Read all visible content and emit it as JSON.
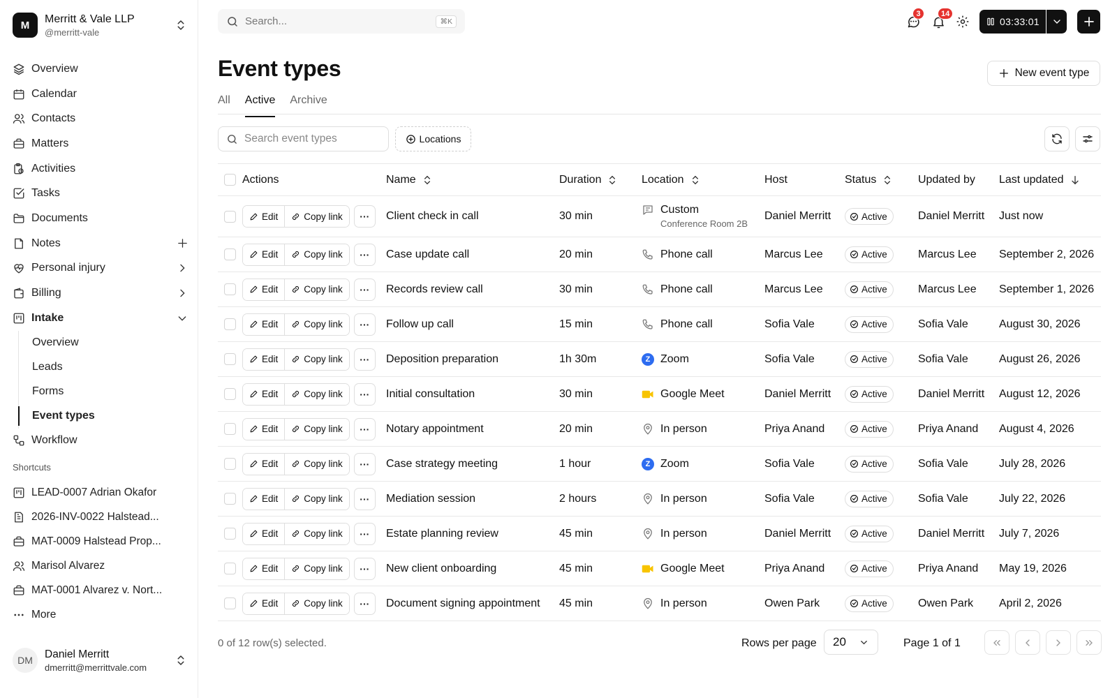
{
  "org": {
    "initial": "M",
    "name": "Merritt & Vale LLP",
    "handle": "@merritt-vale"
  },
  "nav": {
    "items": [
      {
        "label": "Overview",
        "icon": "layers-icon"
      },
      {
        "label": "Calendar",
        "icon": "calendar-icon"
      },
      {
        "label": "Contacts",
        "icon": "users-icon"
      },
      {
        "label": "Matters",
        "icon": "briefcase-icon"
      },
      {
        "label": "Activities",
        "icon": "activity-clipboard-icon"
      },
      {
        "label": "Tasks",
        "icon": "checkbox-icon"
      },
      {
        "label": "Documents",
        "icon": "folder-icon"
      },
      {
        "label": "Notes",
        "icon": "note-icon"
      },
      {
        "label": "Personal injury",
        "icon": "heart-pulse-icon"
      },
      {
        "label": "Billing",
        "icon": "wallet-icon"
      },
      {
        "label": "Intake",
        "icon": "kanban-icon"
      }
    ],
    "intake_sub": [
      "Overview",
      "Leads",
      "Forms",
      "Event types"
    ],
    "workflow": "Workflow"
  },
  "shortcuts": {
    "title": "Shortcuts",
    "items": [
      {
        "label": "LEAD-0007 Adrian Okafor",
        "icon": "kanban-icon"
      },
      {
        "label": "2026-INV-0022 Halstead...",
        "icon": "invoice-icon"
      },
      {
        "label": "MAT-0009 Halstead Prop...",
        "icon": "briefcase-icon"
      },
      {
        "label": "Marisol Alvarez",
        "icon": "users-icon"
      },
      {
        "label": "MAT-0001 Alvarez v. Nort...",
        "icon": "briefcase-icon"
      }
    ],
    "more": "More"
  },
  "user": {
    "initials": "DM",
    "name": "Daniel Merritt",
    "email": "dmerritt@merrittvale.com"
  },
  "topbar": {
    "search_placeholder": "Search...",
    "shortcut": "⌘K",
    "messages_count": "3",
    "notifications_count": "14",
    "timer": "03:33:01"
  },
  "page": {
    "title": "Event types",
    "new_button": "New event type",
    "tabs": [
      "All",
      "Active",
      "Archive"
    ],
    "active_tab": "Active",
    "filter_placeholder": "Search event types",
    "locations_filter": "Locations"
  },
  "table": {
    "columns": {
      "actions": "Actions",
      "name": "Name",
      "duration": "Duration",
      "location": "Location",
      "host": "Host",
      "status": "Status",
      "updated_by": "Updated by",
      "last_updated": "Last updated"
    },
    "edit_label": "Edit",
    "copy_label": "Copy link",
    "more_label": "···",
    "rows": [
      {
        "name": "Client check in call",
        "duration": "30 min",
        "location": "Custom",
        "location_sub": "Conference Room 2B",
        "loc_icon": "message-square-icon",
        "host": "Daniel Merritt",
        "status": "Active",
        "updated_by": "Daniel Merritt",
        "last_updated": "Just now"
      },
      {
        "name": "Case update call",
        "duration": "20 min",
        "location": "Phone call",
        "loc_icon": "phone-icon",
        "host": "Marcus Lee",
        "status": "Active",
        "updated_by": "Marcus Lee",
        "last_updated": "September 2, 2026"
      },
      {
        "name": "Records review call",
        "duration": "30 min",
        "location": "Phone call",
        "loc_icon": "phone-icon",
        "host": "Marcus Lee",
        "status": "Active",
        "updated_by": "Marcus Lee",
        "last_updated": "September 1, 2026"
      },
      {
        "name": "Follow up call",
        "duration": "15 min",
        "location": "Phone call",
        "loc_icon": "phone-icon",
        "host": "Sofia Vale",
        "status": "Active",
        "updated_by": "Sofia Vale",
        "last_updated": "August 30, 2026"
      },
      {
        "name": "Deposition preparation",
        "duration": "1h 30m",
        "location": "Zoom",
        "loc_icon": "zoom-icon",
        "host": "Sofia Vale",
        "status": "Active",
        "updated_by": "Sofia Vale",
        "last_updated": "August 26, 2026"
      },
      {
        "name": "Initial consultation",
        "duration": "30 min",
        "location": "Google Meet",
        "loc_icon": "google-meet-icon",
        "host": "Daniel Merritt",
        "status": "Active",
        "updated_by": "Daniel Merritt",
        "last_updated": "August 12, 2026"
      },
      {
        "name": "Notary appointment",
        "duration": "20 min",
        "location": "In person",
        "loc_icon": "map-pin-icon",
        "host": "Priya Anand",
        "status": "Active",
        "updated_by": "Priya Anand",
        "last_updated": "August 4, 2026"
      },
      {
        "name": "Case strategy meeting",
        "duration": "1 hour",
        "location": "Zoom",
        "loc_icon": "zoom-icon",
        "host": "Sofia Vale",
        "status": "Active",
        "updated_by": "Sofia Vale",
        "last_updated": "July 28, 2026"
      },
      {
        "name": "Mediation session",
        "duration": "2 hours",
        "location": "In person",
        "loc_icon": "map-pin-icon",
        "host": "Sofia Vale",
        "status": "Active",
        "updated_by": "Sofia Vale",
        "last_updated": "July 22, 2026"
      },
      {
        "name": "Estate planning review",
        "duration": "45 min",
        "location": "In person",
        "loc_icon": "map-pin-icon",
        "host": "Daniel Merritt",
        "status": "Active",
        "updated_by": "Daniel Merritt",
        "last_updated": "July 7, 2026"
      },
      {
        "name": "New client onboarding",
        "duration": "45 min",
        "location": "Google Meet",
        "loc_icon": "google-meet-icon",
        "host": "Priya Anand",
        "status": "Active",
        "updated_by": "Priya Anand",
        "last_updated": "May 19, 2026"
      },
      {
        "name": "Document signing appointment",
        "duration": "45 min",
        "location": "In person",
        "loc_icon": "map-pin-icon",
        "host": "Owen Park",
        "status": "Active",
        "updated_by": "Owen Park",
        "last_updated": "April 2, 2026"
      }
    ]
  },
  "footer": {
    "selected_text": "0 of 12 row(s) selected.",
    "rows_per_page_label": "Rows per page",
    "rows_per_page": "20",
    "page_info": "Page 1 of 1"
  },
  "colors": {
    "accent": "#111111",
    "badge": "#e5332f",
    "zoom": "#2d6cf0",
    "meet": "#f8c400"
  }
}
